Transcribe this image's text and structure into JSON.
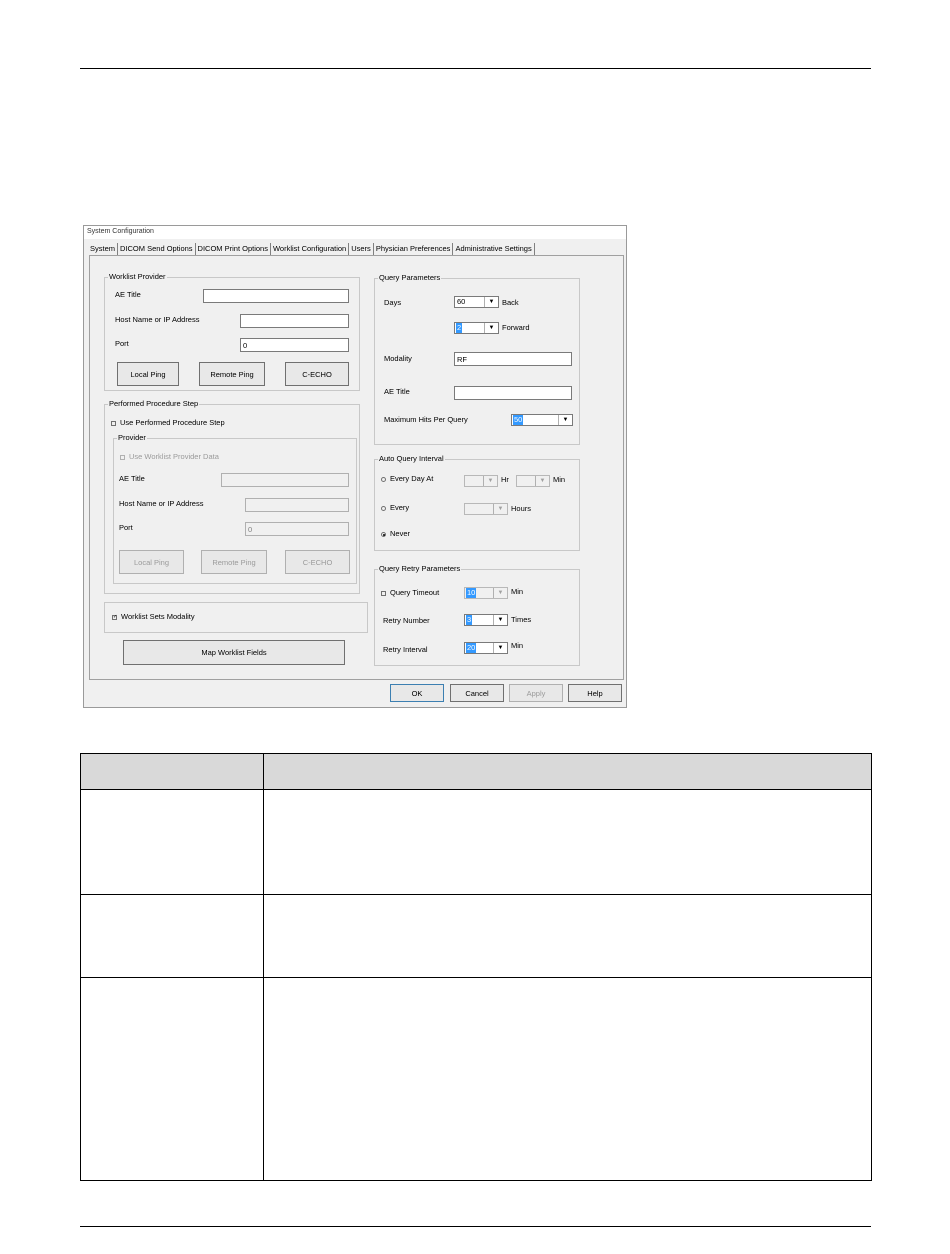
{
  "window": {
    "title": "System Configuration",
    "tabs": [
      "System",
      "DICOM Send Options",
      "DICOM Print Options",
      "Worklist Configuration",
      "Users",
      "Physician Preferences",
      "Administrative Settings"
    ],
    "active_tab": "Worklist Configuration"
  },
  "worklist_provider": {
    "label": "Worklist Provider",
    "ae_title_label": "AE Title",
    "ae_title_value": "",
    "host_label": "Host Name or IP Address",
    "host_value": "",
    "port_label": "Port",
    "port_value": "0",
    "local_ping": "Local Ping",
    "remote_ping": "Remote Ping",
    "cecho": "C-ECHO"
  },
  "pps": {
    "label": "Performed Procedure Step",
    "use_pps_label": "Use Performed Procedure Step",
    "use_pps_checked": false,
    "provider_label": "Provider",
    "use_worklist_data_label": "Use Worklist Provider Data",
    "ae_title_label": "AE Title",
    "ae_title_value": "",
    "host_label": "Host Name or IP Address",
    "host_value": "",
    "port_label": "Port",
    "port_value": "0",
    "local_ping": "Local Ping",
    "remote_ping": "Remote Ping",
    "cecho": "C-ECHO"
  },
  "worklist_sets_modality": {
    "label": "Worklist Sets Modality",
    "checked": true
  },
  "map_fields_button": "Map Worklist Fields",
  "query_params": {
    "label": "Query Parameters",
    "days_label": "Days",
    "days_back_value": "60",
    "back_label": "Back",
    "days_forward_value": "2",
    "forward_label": "Forward",
    "modality_label": "Modality",
    "modality_value": "RF",
    "ae_title_label": "AE Title",
    "ae_title_value": "",
    "max_hits_label": "Maximum Hits Per Query",
    "max_hits_value": "50"
  },
  "auto_query": {
    "label": "Auto Query Interval",
    "every_day_at": "Every Day At",
    "hr": "Hr",
    "min": "Min",
    "every": "Every",
    "hours": "Hours",
    "never": "Never",
    "selected": "Never"
  },
  "retry": {
    "label": "Query Retry Parameters",
    "timeout_label": "Query Timeout",
    "timeout_value": "10",
    "timeout_unit": "Min",
    "retry_number_label": "Retry Number",
    "retry_number_value": "3",
    "retry_number_unit": "Times",
    "retry_interval_label": "Retry Interval",
    "retry_interval_value": "20",
    "retry_interval_unit": "Min"
  },
  "footer_buttons": {
    "ok": "OK",
    "cancel": "Cancel",
    "apply": "Apply",
    "help": "Help"
  },
  "icons": {
    "dropdown": "chevron-down-icon"
  }
}
